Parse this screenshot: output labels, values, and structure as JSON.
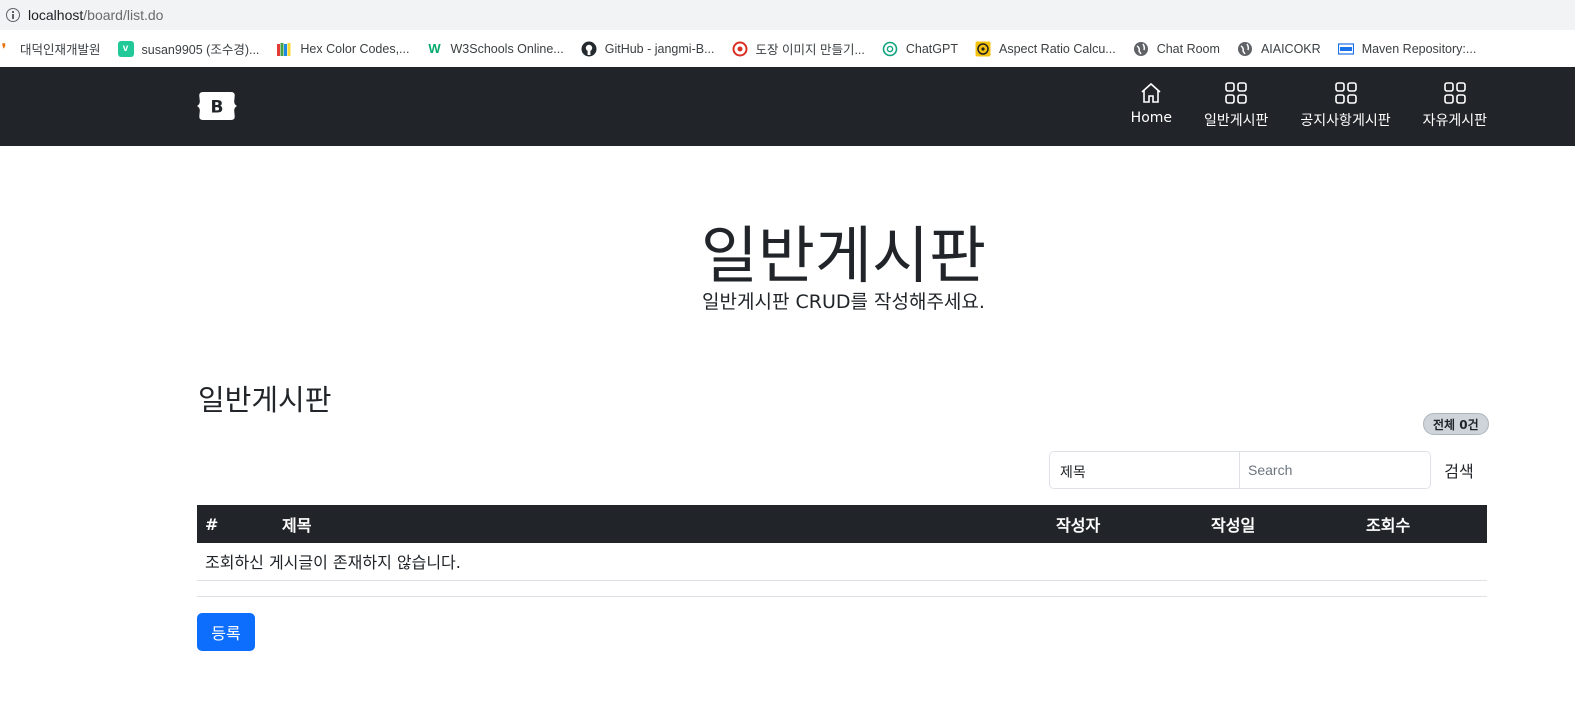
{
  "browser": {
    "url_host": "localhost",
    "url_path": "/board/list.do"
  },
  "bookmarks": [
    {
      "label": "대덕인재개발원",
      "icon": "flame-icon",
      "color": "#e8710a"
    },
    {
      "label": "susan9905 (조수경)...",
      "icon": "v-icon",
      "color": "#20c997"
    },
    {
      "label": "Hex Color Codes,...",
      "icon": "books-icon",
      "color": "#6f42c1"
    },
    {
      "label": "W3Schools Online...",
      "icon": "w3-icon",
      "color": "#04aa6d"
    },
    {
      "label": "GitHub - jangmi-B...",
      "icon": "github-icon",
      "color": "#24292e"
    },
    {
      "label": "도장 이미지 만들기...",
      "icon": "stamp-icon",
      "color": "#d93025"
    },
    {
      "label": "ChatGPT",
      "icon": "chatgpt-icon",
      "color": "#10a37f"
    },
    {
      "label": "Aspect Ratio Calcu...",
      "icon": "aspect-ratio-icon",
      "color": "#f4c20d"
    },
    {
      "label": "Chat Room",
      "icon": "globe-icon",
      "color": "#5f6368"
    },
    {
      "label": "AIAICOKR",
      "icon": "globe-icon",
      "color": "#5f6368"
    },
    {
      "label": "Maven Repository:...",
      "icon": "maven-icon",
      "color": "#1a73e8"
    }
  ],
  "navbar": {
    "brand_letter": "B",
    "items": [
      {
        "label": "Home",
        "icon": "home-icon"
      },
      {
        "label": "일반게시판",
        "icon": "grid-icon"
      },
      {
        "label": "공지사항게시판",
        "icon": "grid-icon"
      },
      {
        "label": "자유게시판",
        "icon": "grid-icon"
      }
    ]
  },
  "hero": {
    "title": "일반게시판",
    "subtitle": "일반게시판 CRUD를 작성해주세요."
  },
  "board": {
    "section_title": "일반게시판",
    "total_badge": "전체 0건",
    "search": {
      "field_selected": "제목",
      "placeholder": "Search",
      "button_label": "검색"
    },
    "columns": [
      "#",
      "제목",
      "작성자",
      "작성일",
      "조회수"
    ],
    "empty_message": "조회하신 게시글이 존재하지 않습니다.",
    "register_label": "등록"
  }
}
